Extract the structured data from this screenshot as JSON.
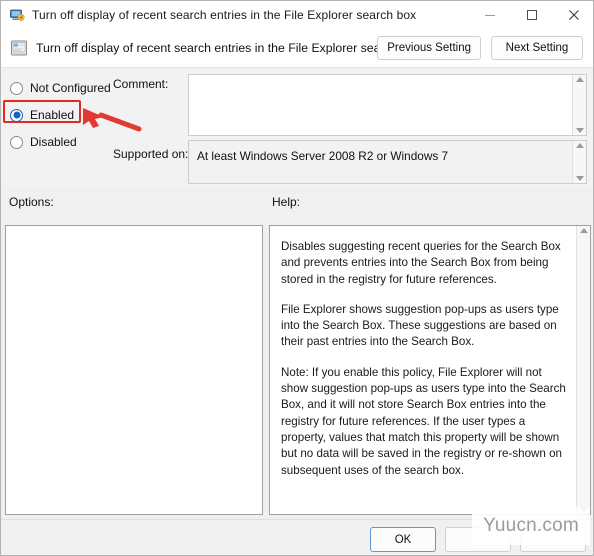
{
  "window": {
    "title": "Turn off display of recent search entries in the File Explorer search box",
    "title_icon": "policy-setting-icon",
    "controls": {
      "minimize": "minimize-icon",
      "maximize": "maximize-icon",
      "close": "close-icon"
    }
  },
  "header": {
    "icon": "policy-document-icon",
    "title": "Turn off display of recent search entries in the File Explorer search box",
    "previous_label": "Previous Setting",
    "next_label": "Next Setting"
  },
  "state": {
    "options": [
      {
        "label": "Not Configured",
        "selected": false
      },
      {
        "label": "Enabled",
        "selected": true
      },
      {
        "label": "Disabled",
        "selected": false
      }
    ],
    "selected_value": "Enabled"
  },
  "comment": {
    "label": "Comment:",
    "value": "",
    "placeholder": ""
  },
  "supported": {
    "label": "Supported on:",
    "value": "At least Windows Server 2008 R2 or Windows 7"
  },
  "panels": {
    "options_label": "Options:",
    "help_label": "Help:",
    "options_content": ""
  },
  "help": {
    "paragraphs": [
      "Disables suggesting recent queries for the Search Box and prevents entries into the Search Box from being stored in the registry for future references.",
      "File Explorer shows suggestion pop-ups as users type into the Search Box.  These suggestions are based on their past entries into the Search Box.",
      "Note: If you enable this policy, File Explorer will not show suggestion pop-ups as users type into the Search Box, and it will not store Search Box entries into the registry for future references.  If the user types a property, values that match this property will be shown but no data will be saved in the registry or re-shown on subsequent uses of the search box."
    ]
  },
  "footer": {
    "ok_label": "OK",
    "cancel_label": "",
    "apply_label": ""
  },
  "annotation": {
    "highlight_target": "Enabled",
    "highlight_color": "#e02a22",
    "arrow_color": "#e03a33"
  },
  "watermark": {
    "text": "Yuucn.com"
  },
  "colors": {
    "accent": "#1565c0",
    "annotation_red": "#e02a22",
    "window_bg": "#f0f0f0",
    "panel_bg": "#ffffff"
  }
}
